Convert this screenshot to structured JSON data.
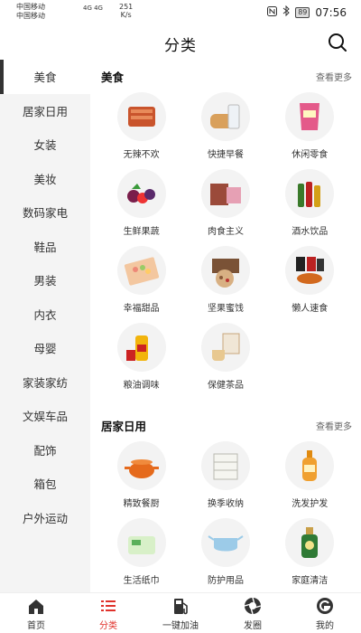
{
  "statusbar": {
    "carrier1": "中国移动",
    "carrier2": "中国移动",
    "net": "4G 4G",
    "speed_value": "251",
    "speed_unit": "K/s",
    "battery": "89",
    "time": "07:56"
  },
  "header": {
    "title": "分类"
  },
  "sidebar": {
    "items": [
      {
        "label": "美食"
      },
      {
        "label": "居家日用"
      },
      {
        "label": "女装"
      },
      {
        "label": "美妆"
      },
      {
        "label": "数码家电"
      },
      {
        "label": "鞋品"
      },
      {
        "label": "男装"
      },
      {
        "label": "内衣"
      },
      {
        "label": "母婴"
      },
      {
        "label": "家装家纺"
      },
      {
        "label": "文娱车品"
      },
      {
        "label": "配饰"
      },
      {
        "label": "箱包"
      },
      {
        "label": "户外运动"
      }
    ]
  },
  "sections": [
    {
      "title": "美食",
      "more": "查看更多",
      "items": [
        {
          "label": "无辣不欢",
          "icon": "spicy-meat-icon"
        },
        {
          "label": "快捷早餐",
          "icon": "bread-milk-icon"
        },
        {
          "label": "休闲零食",
          "icon": "snack-bag-icon"
        },
        {
          "label": "生鲜果蔬",
          "icon": "fruit-icon"
        },
        {
          "label": "肉食主义",
          "icon": "meat-box-icon"
        },
        {
          "label": "酒水饮品",
          "icon": "drinks-icon"
        },
        {
          "label": "幸福甜品",
          "icon": "dessert-box-icon"
        },
        {
          "label": "坚果蜜饯",
          "icon": "nuts-gift-icon"
        },
        {
          "label": "懒人速食",
          "icon": "instant-noodle-icon"
        },
        {
          "label": "粮油调味",
          "icon": "oil-bottle-icon"
        },
        {
          "label": "保健茶品",
          "icon": "tea-set-icon"
        }
      ]
    },
    {
      "title": "居家日用",
      "more": "查看更多",
      "items": [
        {
          "label": "精致餐厨",
          "icon": "cooking-pot-icon"
        },
        {
          "label": "换季收纳",
          "icon": "storage-drawer-icon"
        },
        {
          "label": "洗发护发",
          "icon": "shampoo-bottle-icon"
        },
        {
          "label": "生活纸巾",
          "icon": "tissue-pack-icon"
        },
        {
          "label": "防护用品",
          "icon": "face-mask-icon"
        },
        {
          "label": "家庭清洁",
          "icon": "disinfectant-bottle-icon"
        }
      ]
    }
  ],
  "bottom_nav": [
    {
      "label": "首页",
      "icon": "home-icon",
      "active": false
    },
    {
      "label": "分类",
      "icon": "list-icon",
      "active": true
    },
    {
      "label": "一键加油",
      "icon": "fuel-pump-icon",
      "active": false
    },
    {
      "label": "发圈",
      "icon": "aperture-icon",
      "active": false
    },
    {
      "label": "我的",
      "icon": "profile-g-icon",
      "active": false
    }
  ],
  "colors": {
    "accent": "#e0322b",
    "sidebar_bg": "#f4f4f4",
    "thumb_bg": "#f3f3f3"
  }
}
